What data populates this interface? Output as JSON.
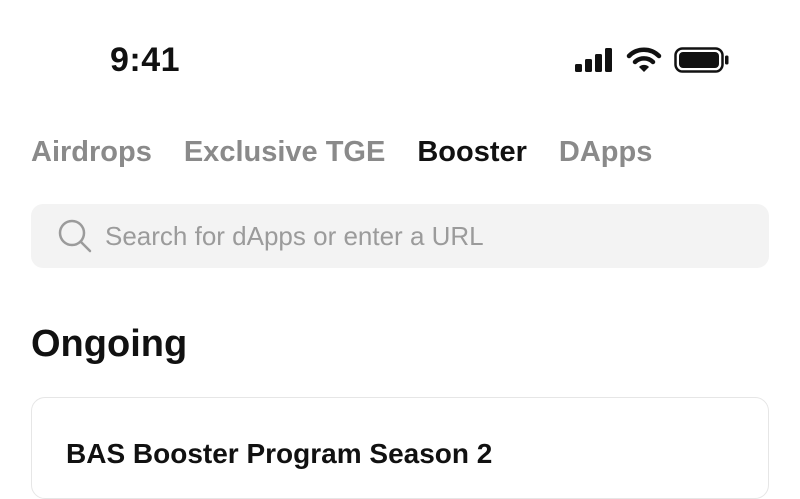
{
  "status_bar": {
    "time": "9:41"
  },
  "tabs": [
    {
      "label": "Airdrops"
    },
    {
      "label": "Exclusive TGE"
    },
    {
      "label": "Booster",
      "active": true
    },
    {
      "label": "DApps"
    }
  ],
  "search": {
    "placeholder": "Search for dApps or enter a URL"
  },
  "section": {
    "title": "Ongoing"
  },
  "card": {
    "title": "BAS Booster Program Season 2"
  },
  "icons": {
    "search": "search-icon",
    "signal": "cellular-signal-icon",
    "wifi": "wifi-icon",
    "battery": "battery-icon"
  }
}
